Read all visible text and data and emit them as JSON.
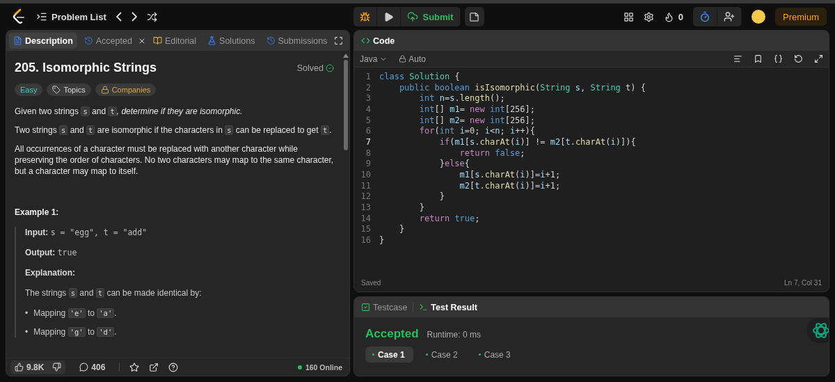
{
  "topbar": {
    "nav_title": "Problem List",
    "submit": "Submit",
    "streak": "0",
    "premium": "Premium"
  },
  "left_tabs": [
    {
      "label": "Description",
      "selected": true,
      "closable": false
    },
    {
      "label": "Accepted",
      "selected": false,
      "closable": true
    },
    {
      "label": "Editorial",
      "selected": false,
      "closable": false
    },
    {
      "label": "Solutions",
      "selected": false,
      "closable": false
    },
    {
      "label": "Submissions",
      "selected": false,
      "closable": false
    }
  ],
  "problem": {
    "title": "205. Isomorphic Strings",
    "status": "Solved",
    "tags": [
      {
        "label": "Easy",
        "kind": "difficulty"
      },
      {
        "label": "Topics",
        "kind": "topics"
      },
      {
        "label": "Companies",
        "kind": "companies"
      }
    ],
    "paragraphs": [
      [
        {
          "kind": "text",
          "t": "Given two strings "
        },
        {
          "kind": "code",
          "t": "s"
        },
        {
          "kind": "text",
          "t": " and "
        },
        {
          "kind": "code",
          "t": "t"
        },
        {
          "kind": "em",
          "t": ", determine if they are isomorphic."
        }
      ],
      [
        {
          "kind": "text",
          "t": "Two strings "
        },
        {
          "kind": "code",
          "t": "s"
        },
        {
          "kind": "text",
          "t": " and "
        },
        {
          "kind": "code",
          "t": "t"
        },
        {
          "kind": "text",
          "t": " are isomorphic if the characters in "
        },
        {
          "kind": "code",
          "t": "s"
        },
        {
          "kind": "text",
          "t": " can be replaced to get "
        },
        {
          "kind": "code",
          "t": "t"
        },
        {
          "kind": "text",
          "t": "."
        }
      ],
      [
        {
          "kind": "text",
          "t": "All occurrences of a character must be replaced with another character while preserving the order of characters. No two characters may map to the same character, but a character may map to itself."
        }
      ]
    ],
    "example": {
      "heading": "Example 1:",
      "input_label": "Input:",
      "input": "s = \"egg\", t = \"add\"",
      "output_label": "Output:",
      "output": "true",
      "explanation_label": "Explanation:",
      "explanation": [
        {
          "kind": "text",
          "t": "The strings "
        },
        {
          "kind": "code",
          "t": "s"
        },
        {
          "kind": "text",
          "t": " and "
        },
        {
          "kind": "code",
          "t": "t"
        },
        {
          "kind": "text",
          "t": " can be made identical by:"
        }
      ],
      "bullets": [
        {
          "marker": "•",
          "segs": [
            {
              "kind": "text",
              "t": "Mapping "
            },
            {
              "kind": "code",
              "t": "'e'"
            },
            {
              "kind": "text",
              "t": " to "
            },
            {
              "kind": "code",
              "t": "'a'"
            },
            {
              "kind": "text",
              "t": "."
            }
          ]
        },
        {
          "marker": "•",
          "segs": [
            {
              "kind": "text",
              "t": "Mapping "
            },
            {
              "kind": "code",
              "t": "'g'"
            },
            {
              "kind": "text",
              "t": " to "
            },
            {
              "kind": "code",
              "t": "'d'"
            },
            {
              "kind": "text",
              "t": "."
            }
          ]
        }
      ]
    }
  },
  "footer": {
    "likes": "9.8K",
    "comments": "406",
    "online": "160 Online"
  },
  "editor": {
    "title": "Code",
    "language": "Java",
    "mode": "Auto",
    "status": "Saved",
    "cursor": "Ln 7, Col 31",
    "lines": [
      {
        "n": "1",
        "active": false,
        "tokens": [
          {
            "t": "class ",
            "kind": "kw"
          },
          {
            "t": "Solution ",
            "kind": "type"
          },
          {
            "t": "{",
            "kind": "p"
          }
        ]
      },
      {
        "n": "2",
        "active": false,
        "tokens": [
          {
            "t": "    public boolean ",
            "kind": "kw"
          },
          {
            "t": "isIsomorphic",
            "kind": "fn"
          },
          {
            "t": "(",
            "kind": "p"
          },
          {
            "t": "String ",
            "kind": "type"
          },
          {
            "t": "s, ",
            "kind": "v"
          },
          {
            "t": "String ",
            "kind": "type"
          },
          {
            "t": "t) {",
            "kind": "p"
          }
        ]
      },
      {
        "n": "3",
        "active": false,
        "tokens": [
          {
            "t": "        int ",
            "kind": "kw"
          },
          {
            "t": "n",
            "kind": "v"
          },
          {
            "t": "=",
            "kind": "p"
          },
          {
            "t": "s",
            "kind": "v"
          },
          {
            "t": ".",
            "kind": "p"
          },
          {
            "t": "length",
            "kind": "fn"
          },
          {
            "t": "();",
            "kind": "p"
          }
        ]
      },
      {
        "n": "4",
        "active": false,
        "tokens": [
          {
            "t": "        int",
            "kind": "kw"
          },
          {
            "t": "[] ",
            "kind": "p"
          },
          {
            "t": "m1",
            "kind": "v"
          },
          {
            "t": "= ",
            "kind": "p"
          },
          {
            "t": "new ",
            "kind": "ctl"
          },
          {
            "t": "int",
            "kind": "kw"
          },
          {
            "t": "[256];",
            "kind": "p"
          }
        ]
      },
      {
        "n": "5",
        "active": false,
        "tokens": [
          {
            "t": "        int",
            "kind": "kw"
          },
          {
            "t": "[] ",
            "kind": "p"
          },
          {
            "t": "m2",
            "kind": "v"
          },
          {
            "t": "= ",
            "kind": "p"
          },
          {
            "t": "new ",
            "kind": "ctl"
          },
          {
            "t": "int",
            "kind": "kw"
          },
          {
            "t": "[256];",
            "kind": "p"
          }
        ]
      },
      {
        "n": "6",
        "active": false,
        "tokens": [
          {
            "t": "        for",
            "kind": "ctl"
          },
          {
            "t": "(",
            "kind": "p"
          },
          {
            "t": "int ",
            "kind": "kw"
          },
          {
            "t": "i",
            "kind": "v"
          },
          {
            "t": "=0; ",
            "kind": "p"
          },
          {
            "t": "i",
            "kind": "v"
          },
          {
            "t": "<",
            "kind": "p"
          },
          {
            "t": "n",
            "kind": "v"
          },
          {
            "t": "; ",
            "kind": "p"
          },
          {
            "t": "i",
            "kind": "v"
          },
          {
            "t": "++){",
            "kind": "p"
          }
        ]
      },
      {
        "n": "7",
        "active": true,
        "tokens": [
          {
            "t": "            if",
            "kind": "ctl"
          },
          {
            "t": "(",
            "kind": "p"
          },
          {
            "t": "m1",
            "kind": "v"
          },
          {
            "t": "[",
            "kind": "p"
          },
          {
            "t": "s",
            "kind": "v"
          },
          {
            "t": ".",
            "kind": "p"
          },
          {
            "t": "charAt",
            "kind": "fn"
          },
          {
            "t": "(",
            "kind": "p"
          },
          {
            "t": "i",
            "kind": "v"
          },
          {
            "t": ")] != ",
            "kind": "p"
          },
          {
            "t": "m2",
            "kind": "v"
          },
          {
            "t": "[",
            "kind": "p"
          },
          {
            "t": "t",
            "kind": "v"
          },
          {
            "t": ".",
            "kind": "p"
          },
          {
            "t": "charAt",
            "kind": "fn"
          },
          {
            "t": "(",
            "kind": "p"
          },
          {
            "t": "i",
            "kind": "v"
          },
          {
            "t": ")]){",
            "kind": "p"
          }
        ]
      },
      {
        "n": "8",
        "active": false,
        "tokens": [
          {
            "t": "                return ",
            "kind": "ctl"
          },
          {
            "t": "false",
            "kind": "kw"
          },
          {
            "t": ";",
            "kind": "p"
          }
        ]
      },
      {
        "n": "9",
        "active": false,
        "tokens": [
          {
            "t": "            }",
            "kind": "p"
          },
          {
            "t": "else",
            "kind": "ctl"
          },
          {
            "t": "{",
            "kind": "p"
          }
        ]
      },
      {
        "n": "10",
        "active": false,
        "tokens": [
          {
            "t": "                m1",
            "kind": "v"
          },
          {
            "t": "[",
            "kind": "p"
          },
          {
            "t": "s",
            "kind": "v"
          },
          {
            "t": ".",
            "kind": "p"
          },
          {
            "t": "charAt",
            "kind": "fn"
          },
          {
            "t": "(",
            "kind": "p"
          },
          {
            "t": "i",
            "kind": "v"
          },
          {
            "t": ")]=",
            "kind": "p"
          },
          {
            "t": "i",
            "kind": "v"
          },
          {
            "t": "+1;",
            "kind": "p"
          }
        ]
      },
      {
        "n": "11",
        "active": false,
        "tokens": [
          {
            "t": "                m2",
            "kind": "v"
          },
          {
            "t": "[",
            "kind": "p"
          },
          {
            "t": "t",
            "kind": "v"
          },
          {
            "t": ".",
            "kind": "p"
          },
          {
            "t": "charAt",
            "kind": "fn"
          },
          {
            "t": "(",
            "kind": "p"
          },
          {
            "t": "i",
            "kind": "v"
          },
          {
            "t": ")]=",
            "kind": "p"
          },
          {
            "t": "i",
            "kind": "v"
          },
          {
            "t": "+1;",
            "kind": "p"
          }
        ]
      },
      {
        "n": "12",
        "active": false,
        "tokens": [
          {
            "t": "            }",
            "kind": "p"
          }
        ]
      },
      {
        "n": "13",
        "active": false,
        "tokens": [
          {
            "t": "        }",
            "kind": "p"
          }
        ]
      },
      {
        "n": "14",
        "active": false,
        "tokens": [
          {
            "t": "        return ",
            "kind": "ctl"
          },
          {
            "t": "true",
            "kind": "kw"
          },
          {
            "t": ";",
            "kind": "p"
          }
        ]
      },
      {
        "n": "15",
        "active": false,
        "tokens": [
          {
            "t": "    }",
            "kind": "p"
          }
        ]
      },
      {
        "n": "16",
        "active": false,
        "tokens": [
          {
            "t": "}",
            "kind": "p"
          }
        ]
      }
    ]
  },
  "test_tabs": [
    {
      "label": "Testcase",
      "selected": false
    },
    {
      "label": "Test Result",
      "selected": true
    }
  ],
  "result": {
    "verdict": "Accepted",
    "runtime": "Runtime: 0 ms",
    "cases": [
      {
        "label": "Case 1",
        "selected": true
      },
      {
        "label": "Case 2",
        "selected": false
      },
      {
        "label": "Case 3",
        "selected": false
      }
    ]
  }
}
